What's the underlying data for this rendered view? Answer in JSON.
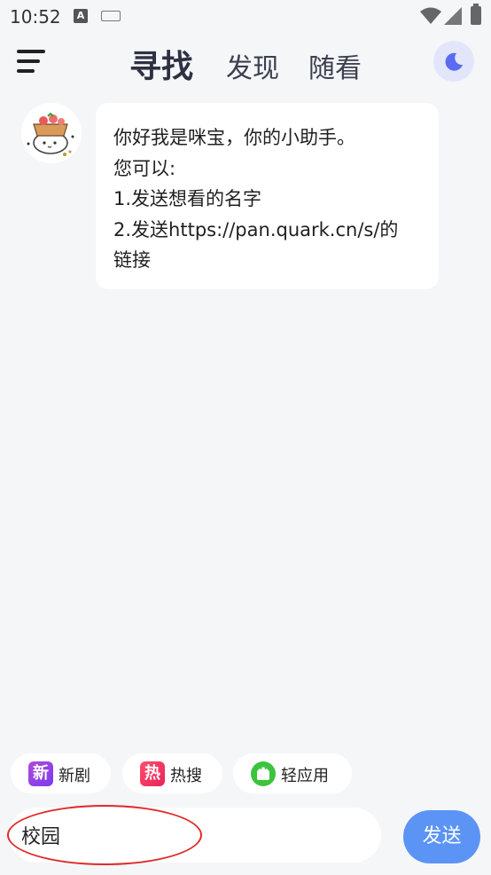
{
  "status_bar": {
    "time": "10:52",
    "a_badge": "A"
  },
  "header": {
    "tabs": [
      {
        "label": "寻找",
        "active": true
      },
      {
        "label": "发现",
        "active": false
      },
      {
        "label": "随看",
        "active": false
      }
    ],
    "accent_color": "#5b6cf0"
  },
  "chat": {
    "bot_message_lines": [
      "你好我是咪宝，你的小助手。",
      "您可以:",
      "1.发送想看的名字",
      "2.发送https://pan.quark.cn/s/的",
      "链接"
    ]
  },
  "quick_actions": [
    {
      "icon_char": "新",
      "label": "新剧",
      "icon": "new-drama-icon"
    },
    {
      "icon_char": "热",
      "label": "热搜",
      "icon": "hot-search-icon"
    },
    {
      "icon_char": "",
      "label": "轻应用",
      "icon": "android-icon"
    }
  ],
  "composer": {
    "input_value": "校园",
    "send_label": "发送",
    "send_color": "#5b94f5"
  }
}
